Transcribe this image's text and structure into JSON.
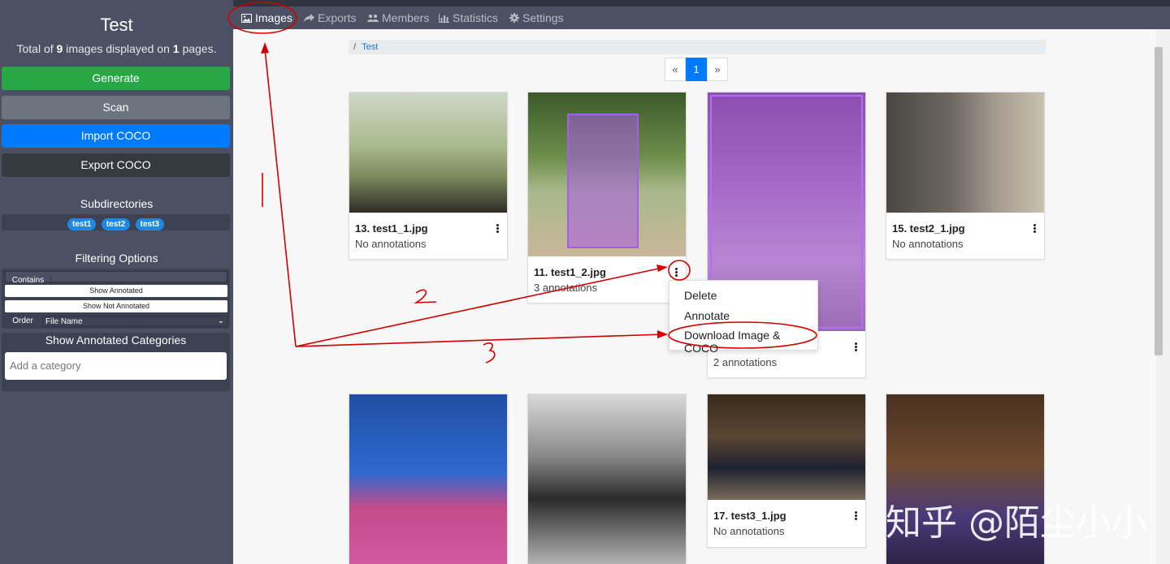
{
  "sidebar": {
    "title": "Test",
    "summary": {
      "prefix": "Total of",
      "images_count": "9",
      "middle": "images displayed on",
      "pages_count": "1",
      "suffix": "pages."
    },
    "buttons": {
      "generate": "Generate",
      "scan": "Scan",
      "import": "Import COCO",
      "export": "Export COCO"
    },
    "subdirectories_title": "Subdirectories",
    "subdirectories": [
      "test1",
      "test2",
      "test3"
    ],
    "filtering_title": "Filtering Options",
    "contains_label": "Contains",
    "show_annotated": "Show Annotated",
    "show_not_annotated": "Show Not Annotated",
    "order_label": "Order",
    "order_value": "File Name",
    "categories_title": "Show Annotated Categories",
    "category_placeholder": "Add a category"
  },
  "nav": {
    "images": "Images",
    "exports": "Exports",
    "members": "Members",
    "statistics": "Statistics",
    "settings": "Settings"
  },
  "breadcrumb": {
    "separator": "/",
    "folder": "Test"
  },
  "pagination": {
    "prev": "«",
    "current": "1",
    "next": "»"
  },
  "cards": [
    {
      "name": "13. test1_1.jpg",
      "annotations": "No annotations"
    },
    {
      "name": "11. test1_2.jpg",
      "annotations": "3 annotations"
    },
    {
      "name": "",
      "annotations": "2 annotations"
    },
    {
      "name": "15. test2_1.jpg",
      "annotations": "No annotations"
    },
    {
      "name": "",
      "annotations": ""
    },
    {
      "name": "",
      "annotations": ""
    },
    {
      "name": "17. test3_1.jpg",
      "annotations": "No annotations"
    },
    {
      "name": "",
      "annotations": ""
    }
  ],
  "dropdown_menu": {
    "delete": "Delete",
    "annotate": "Annotate",
    "download": "Download Image & COCO"
  },
  "markup": {
    "n1": "1",
    "n2": "2",
    "n3": "3"
  },
  "watermark": "知乎 @陌尘小小",
  "colors": {
    "sidebar": "#4b5162",
    "primary": "#007bff",
    "success": "#28a745",
    "annotation_markup": "#d40000"
  }
}
